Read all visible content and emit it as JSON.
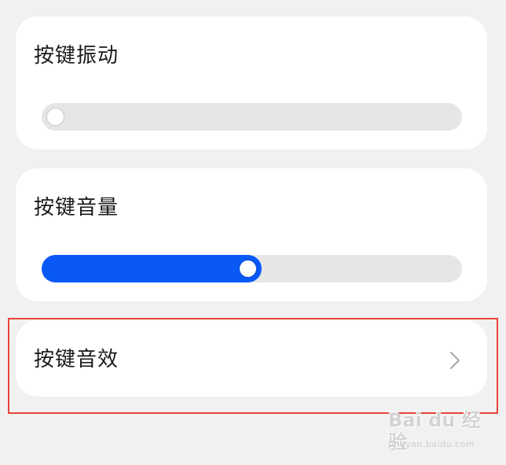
{
  "settings": {
    "vibration": {
      "title": "按键振动",
      "level": 0
    },
    "volume": {
      "title": "按键音量",
      "level": 0.49
    },
    "sound_effect": {
      "title": "按键音效",
      "icon": "chevron-right-icon"
    }
  },
  "colors": {
    "accent": "#0a59f7",
    "track": "#e6e6e6",
    "highlight": "#e8453a"
  },
  "watermark": {
    "main": "Bai du 经验",
    "sub": "jingyan.baidu.com"
  }
}
